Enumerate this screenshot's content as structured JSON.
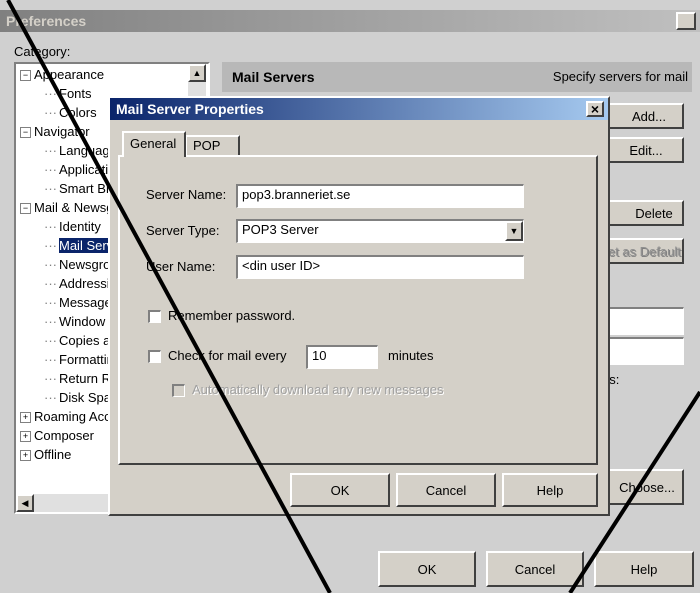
{
  "prefs": {
    "title": "Preferences",
    "close": "×",
    "category_label": "Category:",
    "tree": [
      {
        "label": "Appearance",
        "level": 0,
        "exp": "−"
      },
      {
        "label": "Fonts",
        "level": 1
      },
      {
        "label": "Colors",
        "level": 1
      },
      {
        "label": "Navigator",
        "level": 0,
        "exp": "−"
      },
      {
        "label": "Languages",
        "level": 1
      },
      {
        "label": "Applications",
        "level": 1
      },
      {
        "label": "Smart Browsing",
        "level": 1
      },
      {
        "label": "Mail & Newsgroups",
        "level": 0,
        "exp": "−"
      },
      {
        "label": "Identity",
        "level": 1
      },
      {
        "label": "Mail Servers",
        "level": 1
      },
      {
        "label": "Newsgroup Servers",
        "level": 1
      },
      {
        "label": "Addressing",
        "level": 1
      },
      {
        "label": "Messages",
        "level": 1
      },
      {
        "label": "Window Settings",
        "level": 1
      },
      {
        "label": "Copies and Folders",
        "level": 1
      },
      {
        "label": "Formatting",
        "level": 1
      },
      {
        "label": "Return Receipts",
        "level": 1
      },
      {
        "label": "Disk Space",
        "level": 1
      },
      {
        "label": "Roaming Access",
        "level": 0,
        "exp": "+"
      },
      {
        "label": "Composer",
        "level": 0,
        "exp": "+"
      },
      {
        "label": "Offline",
        "level": 0,
        "exp": "+"
      }
    ],
    "section_title": "Mail Servers",
    "section_desc": "Specify servers for mail",
    "buttons": {
      "add": "Add...",
      "edit": "Edit...",
      "delete": "Delete",
      "set_default": "Set as Default",
      "choose": "Choose...",
      "ok": "OK",
      "cancel": "Cancel",
      "help": "Help"
    },
    "partial_text": "es:"
  },
  "dialog": {
    "title": "Mail Server Properties",
    "close": "×",
    "tabs": [
      "General",
      "POP"
    ],
    "server_name_label": "Server Name:",
    "server_name_value": "pop3.branneriet.se",
    "server_type_label": "Server Type:",
    "server_type_value": "POP3 Server",
    "user_name_label": "User Name:",
    "user_name_value": "<din user ID>",
    "remember_password": "Remember password.",
    "check_mail_label": "Check for mail every",
    "check_mail_minutes": "10",
    "minutes_label": "minutes",
    "auto_download": "Automatically download any new messages",
    "ok": "OK",
    "cancel": "Cancel",
    "help": "Help"
  }
}
